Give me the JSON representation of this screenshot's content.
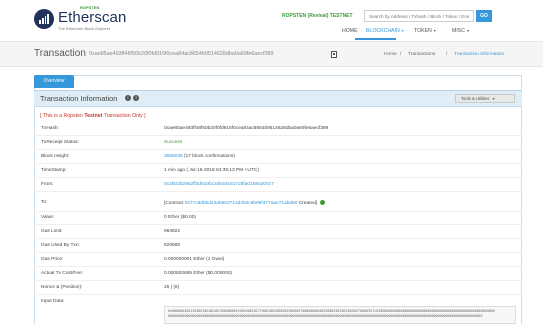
{
  "brand": {
    "name": "Etherscan",
    "badge": "ROPSTEN",
    "tagline": "The Ethereum Block Explorer"
  },
  "network_label": "ROPSTEN (Revival) TESTNET",
  "search": {
    "placeholder": "Search by Address / Txhash / Block / Token / Ens",
    "go_label": "GO"
  },
  "nav": {
    "home": "HOME",
    "blockchain": "BLOCKCHAIN",
    "token": "TOKEN",
    "misc": "MISC"
  },
  "title": {
    "label": "Transaction",
    "hash": "0xae85ae493ff48f50b20f0fd916f0cea84ac8654b9514628dba0a69fe6aecf389"
  },
  "breadcrumb": {
    "home": "Home",
    "transactions": "Transactions",
    "current": "Transaction Information"
  },
  "tab_overview": "Overview",
  "panel": {
    "title": "Transaction Information",
    "tools_label": "Tools & Utilities"
  },
  "ropsten_note": {
    "prefix": "[ This is a Ropsten ",
    "emph": "Testnet",
    "suffix": " Transaction Only ]"
  },
  "rows": [
    {
      "label": "TxHash:",
      "value": "0xae85ae493ff48f50b20f0fd916f0cea84ac8654b9514628dba0a69fe6aecf389"
    },
    {
      "label": "TxReceipt Status:",
      "value": "Success"
    },
    {
      "label": "Block Height:",
      "value": "3658036",
      "extra": "(17 block confirmations)"
    },
    {
      "label": "TimeStamp:",
      "value": "1 min ago ( Jul-16-2018 04:35:13 PM +UTC)"
    },
    {
      "label": "From:",
      "value": "0x2b03b2952ff3d610bc3db40161728fa0158a200c7"
    },
    {
      "label": "To:",
      "value_prefix": "[Contract ",
      "value": "0x77c8d0bd23ab502712d4b0c9b99f477aae71abd60",
      "value_suffix": " Created]"
    },
    {
      "label": "Value:",
      "value": "0 Ether ($0.00)"
    },
    {
      "label": "Gas Limit:",
      "value": "984822"
    },
    {
      "label": "Gas Used By Txn:",
      "value": "820685"
    },
    {
      "label": "Gas Price:",
      "value": "0.000000001 Ether (1 Gwei)"
    },
    {
      "label": "Actual Tx Cost/Fee:",
      "value": "0.000820685 Ether ($0.000000)"
    },
    {
      "label": "Nonce & {Position}:",
      "value": "26 | {6}"
    },
    {
      "label": "Input Data:"
    }
  ],
  "input_data": [
    "0x60806040523480156100105760008060fd5b5061027f806100206000396000f300608060405260043610610056576000357c0100000000000000000000000000000000000000000000000000000000",
    "0000000000000000000000000000000000000000000000000000000000000000000000000000000000000000000000000000000000000000000000000000000000000000000000000000000000"
  ],
  "colors": {
    "accent": "#3498db",
    "success": "#3c9a3c",
    "brand": "#21325b",
    "note": "#c0392b"
  },
  "icons": [
    "etherscan-logo-icon",
    "copy-icon",
    "info-icon",
    "help-icon",
    "check-circle-icon"
  ]
}
